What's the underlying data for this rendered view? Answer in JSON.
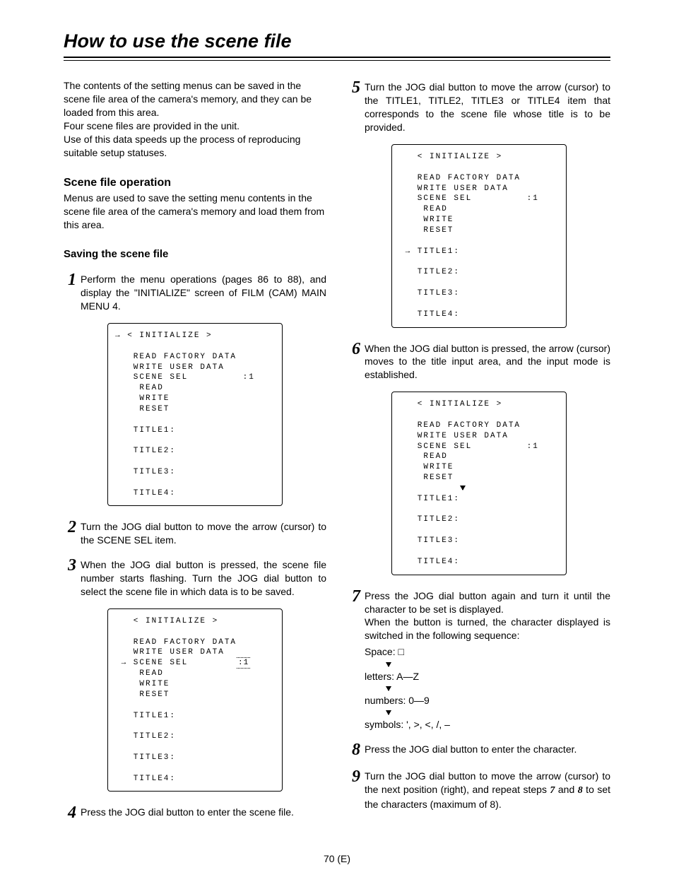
{
  "title": "How to use the scene file",
  "intro": {
    "p1": "The contents of the setting menus can be saved in the scene file area of the camera's memory, and they can be loaded from this area.",
    "p2": "Four scene files are provided in the unit.",
    "p3": "Use of this data speeds up the process of reproducing suitable setup statuses."
  },
  "section1": {
    "heading": "Scene file operation",
    "body": "Menus are used to save the setting menu contents in the scene file area of the camera's memory and load them from this area."
  },
  "section2": {
    "heading": "Saving the scene file"
  },
  "steps": {
    "s1": "Perform the menu operations (pages 86 to 88), and display the \"INITIALIZE\" screen of FILM (CAM) MAIN MENU 4.",
    "s2": "Turn the JOG dial button to move the arrow (cursor) to the SCENE SEL item.",
    "s3": "When the JOG dial button is pressed, the scene file number starts flashing.  Turn the JOG dial button to select the scene file in which data is to be saved.",
    "s4": "Press the JOG dial button to enter the scene file.",
    "s5": "Turn the JOG dial button to move the arrow (cursor) to the TITLE1, TITLE2, TITLE3 or TITLE4 item that corresponds to the scene file whose title is to be provided.",
    "s6": "When the JOG dial button is pressed, the arrow (cursor) moves to the title input area, and the input mode is established.",
    "s7_a": "Press the JOG dial button again and turn it until the character to be set is displayed.",
    "s7_b": "When the button is turned, the character displayed is switched in the following sequence:",
    "seq_space": "Space: □",
    "seq_letters": "letters: A—Z",
    "seq_numbers": "numbers: 0—9",
    "seq_symbols": "symbols: ', >, <, /, –",
    "s8": "Press the JOG dial button to enter the character.",
    "s9_a": "Turn the JOG dial button to move the arrow (cursor) to the next position (right), and repeat steps ",
    "s9_b": " and ",
    "s9_c": " to set the characters (maximum of 8).",
    "s9_ref1": "7",
    "s9_ref2": "8"
  },
  "screens": {
    "scr1": "→ < INITIALIZE >\n\n   READ FACTORY DATA\n   WRITE USER DATA\n   SCENE SEL         :1\n    READ\n    WRITE\n    RESET\n\n   TITLE1:\n\n   TITLE2:\n\n   TITLE3:\n\n   TITLE4:\n",
    "scr3_pre": "   < INITIALIZE >\n\n   READ FACTORY DATA\n   WRITE USER DATA\n → SCENE SEL        ",
    "scr3_val": ":1",
    "scr3_post": "\n    READ\n    WRITE\n    RESET\n\n   TITLE1:\n\n   TITLE2:\n\n   TITLE3:\n\n   TITLE4:\n",
    "scr5": "   < INITIALIZE >\n\n   READ FACTORY DATA\n   WRITE USER DATA\n   SCENE SEL         :1\n    READ\n    WRITE\n    RESET\n\n → TITLE1:\n\n   TITLE2:\n\n   TITLE3:\n\n   TITLE4:\n",
    "scr6_a": "   < INITIALIZE >\n\n   READ FACTORY DATA\n   WRITE USER DATA\n   SCENE SEL         :1\n    READ\n    WRITE\n    RESET",
    "scr6_b": "   TITLE1:\n\n   TITLE2:\n\n   TITLE3:\n\n   TITLE4:\n"
  },
  "page_number": "70 (E)"
}
